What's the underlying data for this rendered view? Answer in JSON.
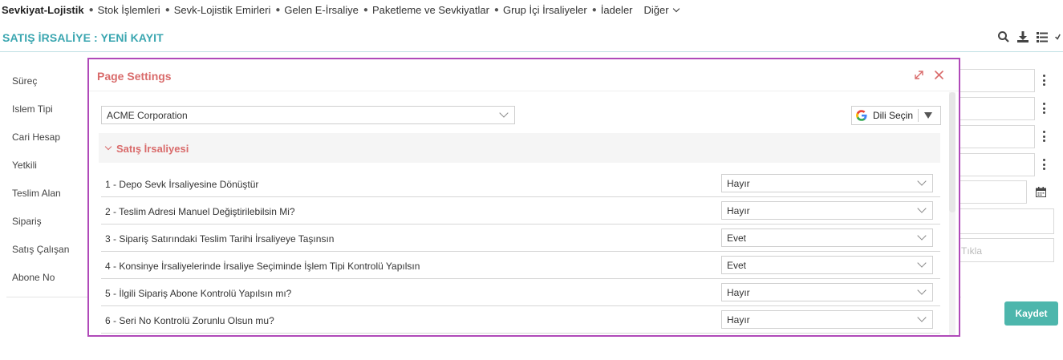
{
  "topnav": {
    "brand": "Sevkiyat-Lojistik",
    "items": [
      "Stok İşlemleri",
      "Sevk-Lojistik Emirleri",
      "Gelen E-İrsaliye",
      "Paketleme ve Sevkiyatlar",
      "Grup İçi İrsaliyeler",
      "İadeler"
    ],
    "more": "Diğer"
  },
  "page": {
    "title": "SATIŞ İRSALİYE : YENİ KAYIT"
  },
  "form": {
    "labels": [
      "Süreç",
      "Islem Tipi",
      "Cari Hesap",
      "Yetkili",
      "Teslim Alan",
      "Sipariş",
      "Satış Çalışan",
      "Abone No"
    ],
    "upload_placeholder": "Tıkla",
    "save_label": "Kaydet"
  },
  "modal": {
    "title": "Page Settings",
    "company": "ACME Corporation",
    "language_label": "Dili Seçin",
    "section_title": "Satış İrsaliyesi",
    "settings": [
      {
        "label": "1 - Depo Sevk İrsaliyesine Dönüştür",
        "value": "Hayır"
      },
      {
        "label": "2 - Teslim Adresi Manuel Değiştirilebilsin Mi?",
        "value": "Hayır"
      },
      {
        "label": "3 - Sipariş Satırındaki Teslim Tarihi İrsaliyeye Taşınsın",
        "value": "Evet"
      },
      {
        "label": "4 - Konsinye İrsaliyelerinde İrsaliye Seçiminde İşlem Tipi Kontrolü Yapılsın",
        "value": "Evet"
      },
      {
        "label": "5 - İlgili Sipariş Abone Kontrolü Yapılsın mı?",
        "value": "Hayır"
      },
      {
        "label": "6 - Seri No Kontrolü Zorunlu Olsun mu?",
        "value": "Hayır"
      }
    ]
  },
  "colors": {
    "accent": "#3aa6b0",
    "modal_title": "#d96b6b",
    "highlight_border": "#b04ab9",
    "save_button": "#4db6ac"
  }
}
